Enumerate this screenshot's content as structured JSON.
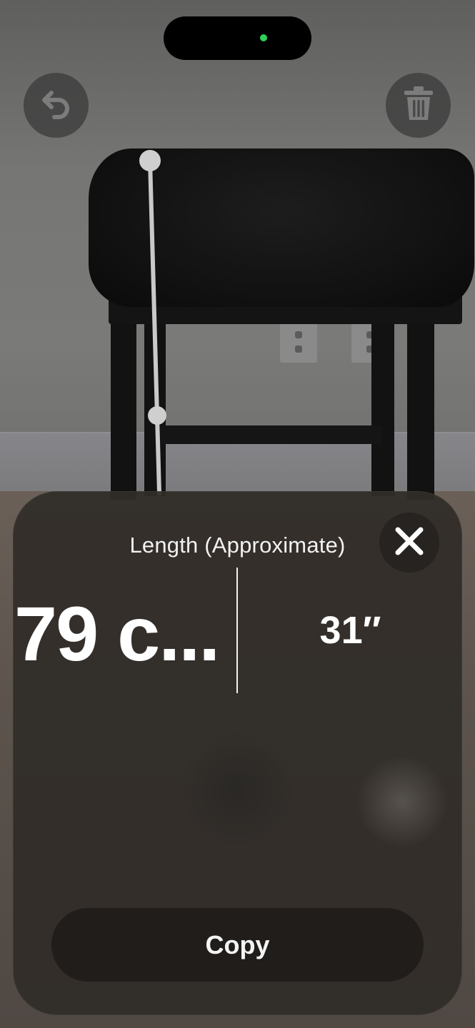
{
  "measurement": {
    "title": "Length (Approximate)",
    "metric_value": "79 c...",
    "imperial_value": "31″"
  },
  "actions": {
    "copy_label": "Copy"
  },
  "icons": {
    "undo": "undo-arrow-icon",
    "delete": "trash-icon",
    "close": "close-x-icon"
  },
  "colors": {
    "camera_indicator": "#2fd158",
    "sheet_background": "#302c28",
    "measure_line": "#c9c9c9"
  }
}
